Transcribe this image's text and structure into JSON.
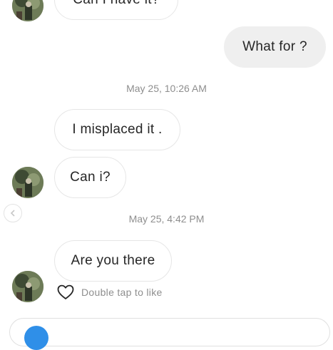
{
  "messages": {
    "top_partial": "Can I have it?",
    "what_for": "What for ?",
    "misplaced": "I misplaced it .",
    "can_i": "Can i?",
    "are_you_there": "Are you there"
  },
  "timestamps": {
    "first": "May 25, 10:26 AM",
    "second": "May 25, 4:42 PM"
  },
  "like_hint": "Double tap to like",
  "icons": [
    "back-chevron-icon",
    "heart-icon"
  ],
  "colors": {
    "incoming_border": "#e6e6e6",
    "outgoing_bg": "#efefef",
    "timestamp": "#8e8e8e",
    "accent": "#2f8fe8"
  }
}
